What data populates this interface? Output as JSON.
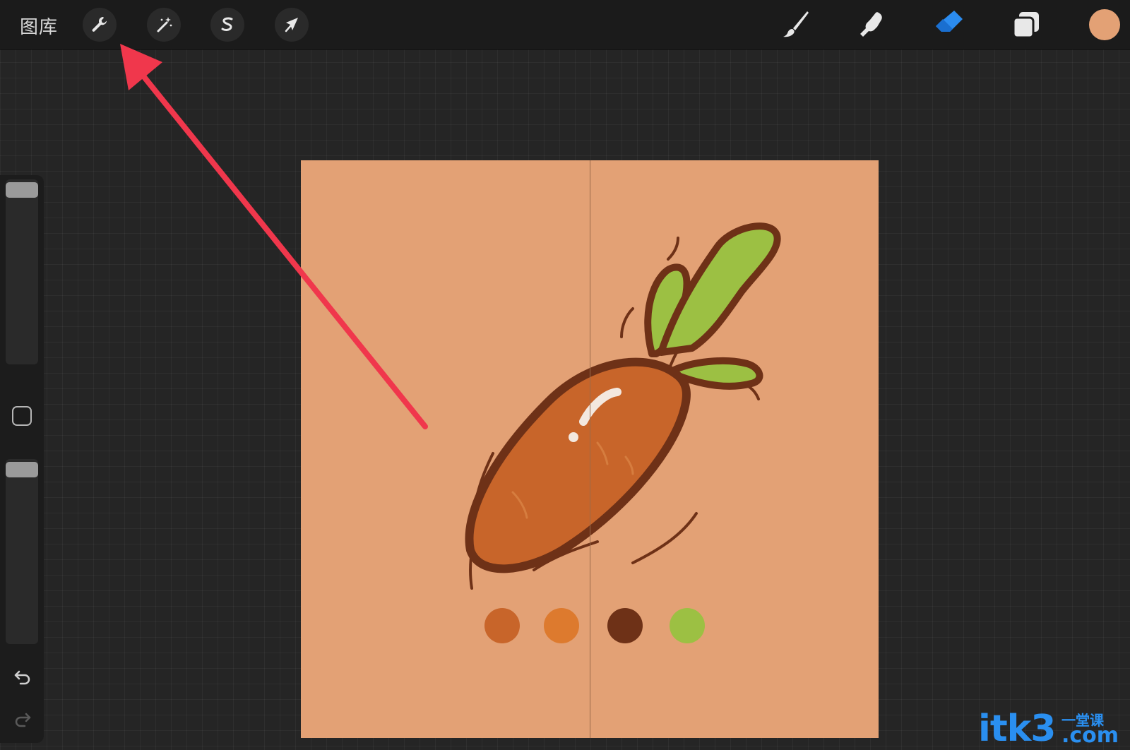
{
  "topbar": {
    "gallery_label": "图库",
    "left_tools": [
      {
        "name": "actions",
        "icon": "wrench-icon"
      },
      {
        "name": "adjustments",
        "icon": "magic-wand-icon"
      },
      {
        "name": "selection",
        "icon": "selection-s-icon"
      },
      {
        "name": "transform",
        "icon": "cursor-arrow-icon"
      }
    ],
    "right_tools": [
      {
        "name": "brush",
        "icon": "brush-icon"
      },
      {
        "name": "smudge",
        "icon": "smudge-finger-icon"
      },
      {
        "name": "eraser",
        "icon": "eraser-icon",
        "active": true
      },
      {
        "name": "layers",
        "icon": "layers-icon"
      }
    ],
    "current_color": "#e3a175"
  },
  "sidebar": {
    "brush_size_level": 1.0,
    "opacity_level": 1.0,
    "modify_icon": "square-icon",
    "undo_icon": "undo-icon",
    "redo_icon": "redo-icon"
  },
  "canvas": {
    "background": "#e3a175",
    "illustration": "carrot",
    "swatches": [
      "#c8652a",
      "#dd7a2e",
      "#6e3117",
      "#9cc043"
    ]
  },
  "annotation": {
    "type": "red-arrow",
    "color": "#f0374c",
    "points_to": "wrench-icon"
  },
  "watermark": {
    "main": "itk3",
    "cn": "一堂课",
    "domain": ".com",
    "color": "#2a8ff0"
  }
}
